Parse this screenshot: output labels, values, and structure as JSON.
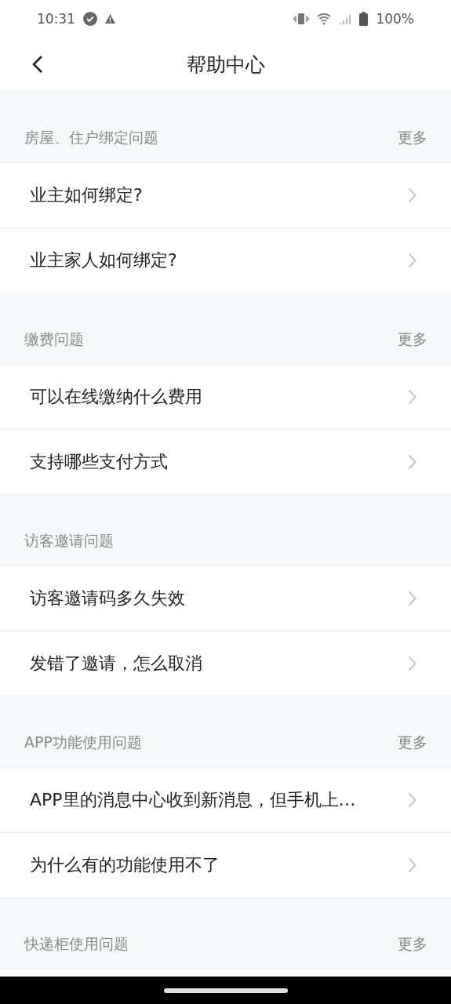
{
  "status_bar": {
    "time": "10:31",
    "battery": "100%"
  },
  "header": {
    "title": "帮助中心"
  },
  "sections": [
    {
      "title": "房屋、住户绑定问题",
      "more": "更多",
      "items": [
        "业主如何绑定?",
        "业主家人如何绑定?"
      ]
    },
    {
      "title": "缴费问题",
      "more": "更多",
      "items": [
        "可以在线缴纳什么费用",
        "支持哪些支付方式"
      ]
    },
    {
      "title": "访客邀请问题",
      "items": [
        "访客邀请码多久失效",
        "发错了邀请，怎么取消"
      ]
    },
    {
      "title": "APP功能使用问题",
      "more": "更多",
      "items": [
        "APP里的消息中心收到新消息，但手机上…",
        "为什么有的功能使用不了"
      ]
    },
    {
      "title": "快递柜使用问题",
      "more": "更多"
    }
  ]
}
